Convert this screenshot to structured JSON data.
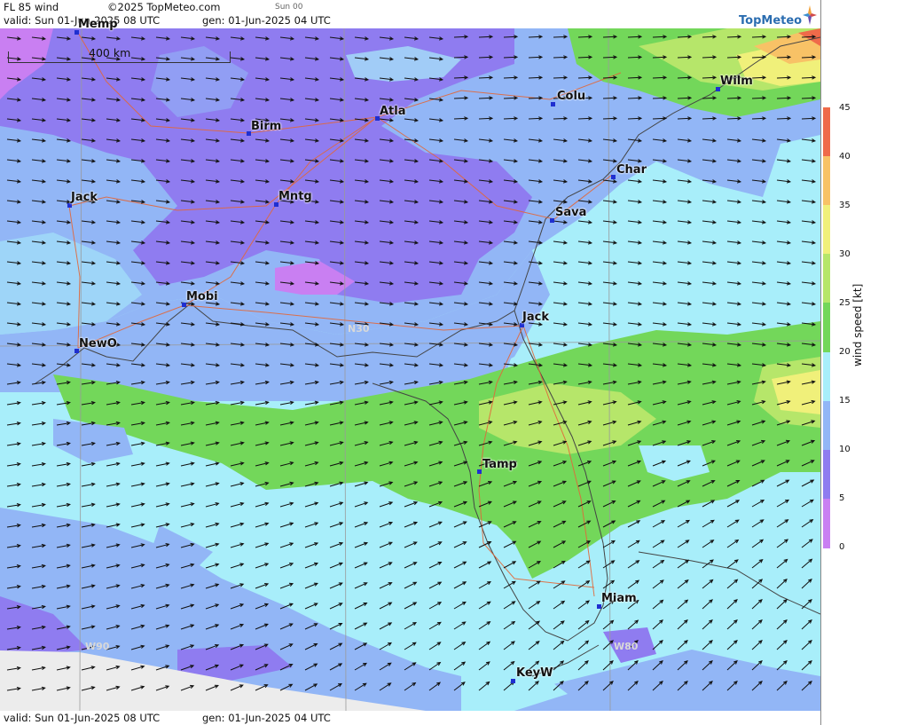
{
  "header": {
    "title": "FL 85 wind",
    "copyright": "©2025 TopMeteo.com",
    "day_tag": "Sun 00",
    "valid": "valid:  Sun  01-Jun-2025  08 UTC",
    "generated": "gen: 01-Jun-2025 04 UTC"
  },
  "footer": {
    "valid": "valid:  Sun  01-Jun-2025  08 UTC",
    "generated": "gen: 01-Jun-2025 04 UTC"
  },
  "brand": {
    "name": "TopMeteo"
  },
  "scale_bar": {
    "label": "400 km"
  },
  "grid_labels": {
    "lat": "N30",
    "lon_west": "W90",
    "lon_east": "W80"
  },
  "cities": [
    {
      "key": "memp",
      "label": "Memp"
    },
    {
      "key": "birm",
      "label": "Birm"
    },
    {
      "key": "atla",
      "label": "Atla"
    },
    {
      "key": "colu",
      "label": "Colu"
    },
    {
      "key": "wilm",
      "label": "Wilm"
    },
    {
      "key": "jack_ms",
      "label": "Jack"
    },
    {
      "key": "mntg",
      "label": "Mntg"
    },
    {
      "key": "char",
      "label": "Char"
    },
    {
      "key": "sava",
      "label": "Sava"
    },
    {
      "key": "mobi",
      "label": "Mobi"
    },
    {
      "key": "jack_fl",
      "label": "Jack"
    },
    {
      "key": "newo",
      "label": "NewO"
    },
    {
      "key": "tamp",
      "label": "Tamp"
    },
    {
      "key": "miam",
      "label": "Miam"
    },
    {
      "key": "keyw",
      "label": "KeyW"
    }
  ],
  "legend": {
    "title": "wind speed [kt]",
    "ticks": [
      "45",
      "40",
      "35",
      "30",
      "25",
      "20",
      "15",
      "10",
      "5",
      "0"
    ],
    "colors": {
      "0_5": "#c97ff2",
      "5_10": "#8f7cf0",
      "10_15": "#92b6f6",
      "15_20": "#a8eefa",
      "20_25": "#73d75a",
      "25_30": "#b6e66a",
      "30_35": "#f0f07a",
      "35_40": "#f8c266",
      "40_45": "#ef6a4a"
    }
  }
}
